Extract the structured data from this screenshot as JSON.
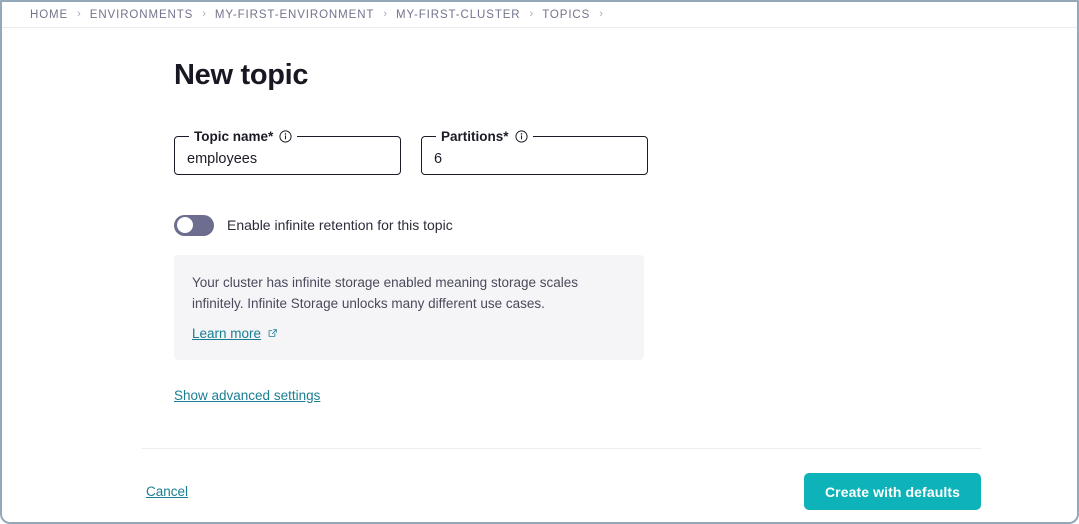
{
  "breadcrumb": {
    "separator": "›",
    "items": [
      {
        "label": "HOME"
      },
      {
        "label": "ENVIRONMENTS"
      },
      {
        "label": "MY-FIRST-ENVIRONMENT"
      },
      {
        "label": "MY-FIRST-CLUSTER"
      },
      {
        "label": "TOPICS"
      }
    ]
  },
  "page": {
    "title": "New topic"
  },
  "form": {
    "topic_name": {
      "label": "Topic name*",
      "value": "employees",
      "placeholder": "",
      "info_icon": "info-circle-icon"
    },
    "partitions": {
      "label": "Partitions*",
      "value": "6",
      "placeholder": "",
      "info_icon": "info-circle-icon"
    },
    "retention_toggle": {
      "label": "Enable infinite retention for this topic",
      "state": "off"
    },
    "advanced_link": "Show advanced settings"
  },
  "info_panel": {
    "text": "Your cluster has infinite storage enabled meaning storage scales infinitely. Infinite Storage unlocks many different use cases.",
    "link_label": "Learn more",
    "link_icon": "external-link-icon"
  },
  "footer": {
    "cancel_label": "Cancel",
    "submit_label": "Create with defaults"
  },
  "colors": {
    "accent_teal": "#0eb3b9",
    "link_teal": "#1a7e92",
    "frame_border": "#93a8b8",
    "toggle_track": "#6c6d8f",
    "panel_bg": "#f5f5f7",
    "breadcrumb_text": "#73748d"
  }
}
